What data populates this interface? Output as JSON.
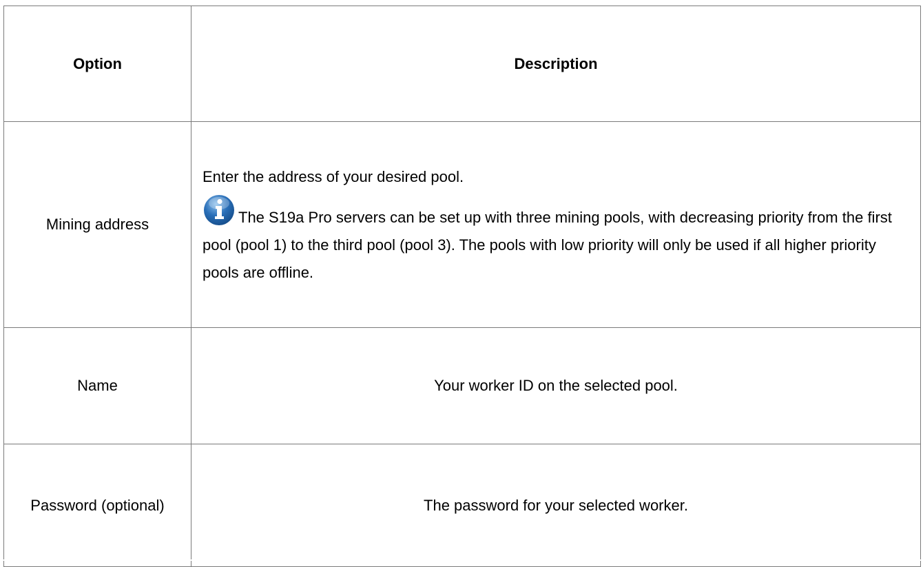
{
  "table": {
    "headers": {
      "option": "Option",
      "description": "Description"
    },
    "rows": [
      {
        "option": "Mining address",
        "description": "Enter the address of your desired pool.",
        "note": {
          "icon": "info-icon",
          "text": "The S19a Pro servers can be set up with three mining pools, with decreasing priority from the first pool (pool 1) to the third pool (pool 3). The pools with low priority will only be used if all higher priority pools are offline."
        }
      },
      {
        "option": "Name",
        "description": "Your worker ID on the selected pool."
      },
      {
        "option": "Password (optional)",
        "description": "The password for your selected worker."
      }
    ]
  },
  "colors": {
    "border": "#7a7a7a",
    "info_icon_blue": "#2a6fb8",
    "info_icon_highlight": "#8cc0ec"
  }
}
